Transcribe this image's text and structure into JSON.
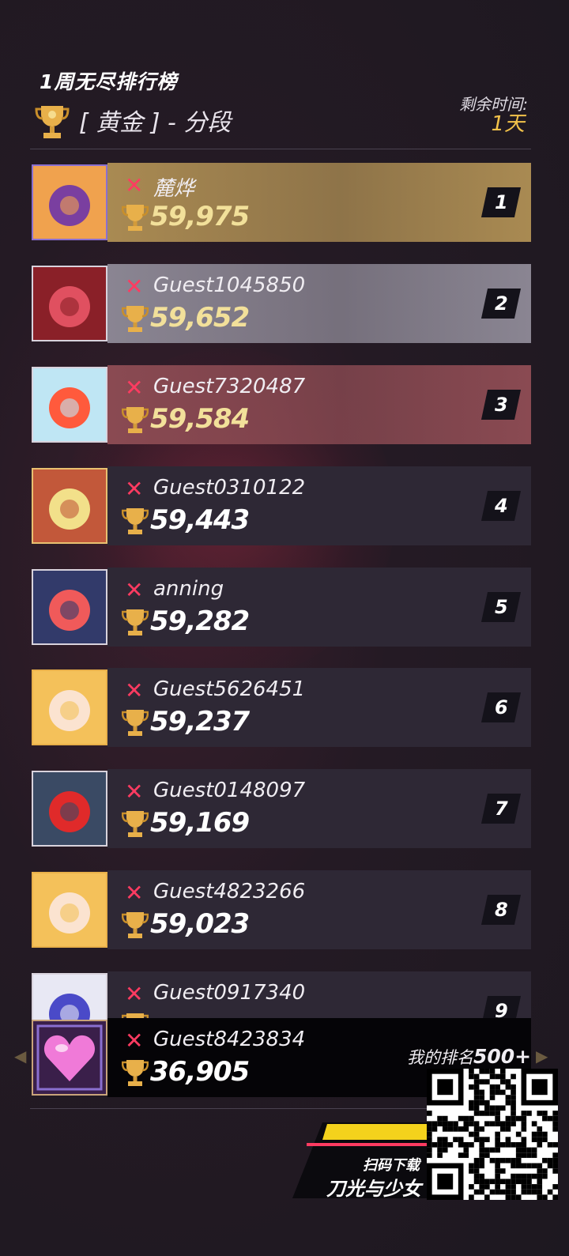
{
  "header": {
    "title": "1周无尽排行榜",
    "tier": "[ 黄金 ] - 分段",
    "time_label": "剩余时间:",
    "time_value": "1天"
  },
  "rows": [
    {
      "rank": "1",
      "name": "麓烨",
      "score": "59,975",
      "highlight": "#a98a52",
      "score_color": "#f2e09a"
    },
    {
      "rank": "2",
      "name": "Guest1045850",
      "score": "59,652",
      "highlight": "#8a8592",
      "score_color": "#f2e09a"
    },
    {
      "rank": "3",
      "name": "Guest7320487",
      "score": "59,584",
      "highlight": "#8a4a52",
      "score_color": "#f2e09a"
    },
    {
      "rank": "4",
      "name": "Guest0310122",
      "score": "59,443",
      "highlight": "#2e2835",
      "score_color": "#ffffff"
    },
    {
      "rank": "5",
      "name": "anning",
      "score": "59,282",
      "highlight": "#2e2835",
      "score_color": "#ffffff"
    },
    {
      "rank": "6",
      "name": "Guest5626451",
      "score": "59,237",
      "highlight": "#2e2835",
      "score_color": "#ffffff"
    },
    {
      "rank": "7",
      "name": "Guest0148097",
      "score": "59,169",
      "highlight": "#2e2835",
      "score_color": "#ffffff"
    },
    {
      "rank": "8",
      "name": "Guest4823266",
      "score": "59,023",
      "highlight": "#2e2835",
      "score_color": "#ffffff"
    },
    {
      "rank": "9",
      "name": "Guest0917340",
      "score": "",
      "highlight": "#2e2835",
      "score_color": "#ffffff"
    }
  ],
  "my_entry": {
    "name": "Guest8423834",
    "score": "36,905",
    "rank_label": "我的排名",
    "rank_value": "500+"
  },
  "promo": {
    "line1": "扫码下载",
    "line2": "刀光与少女"
  },
  "icons": {
    "trophy": "trophy-icon",
    "remove": "x-mark-icon",
    "qr": "qr-code-icon"
  }
}
